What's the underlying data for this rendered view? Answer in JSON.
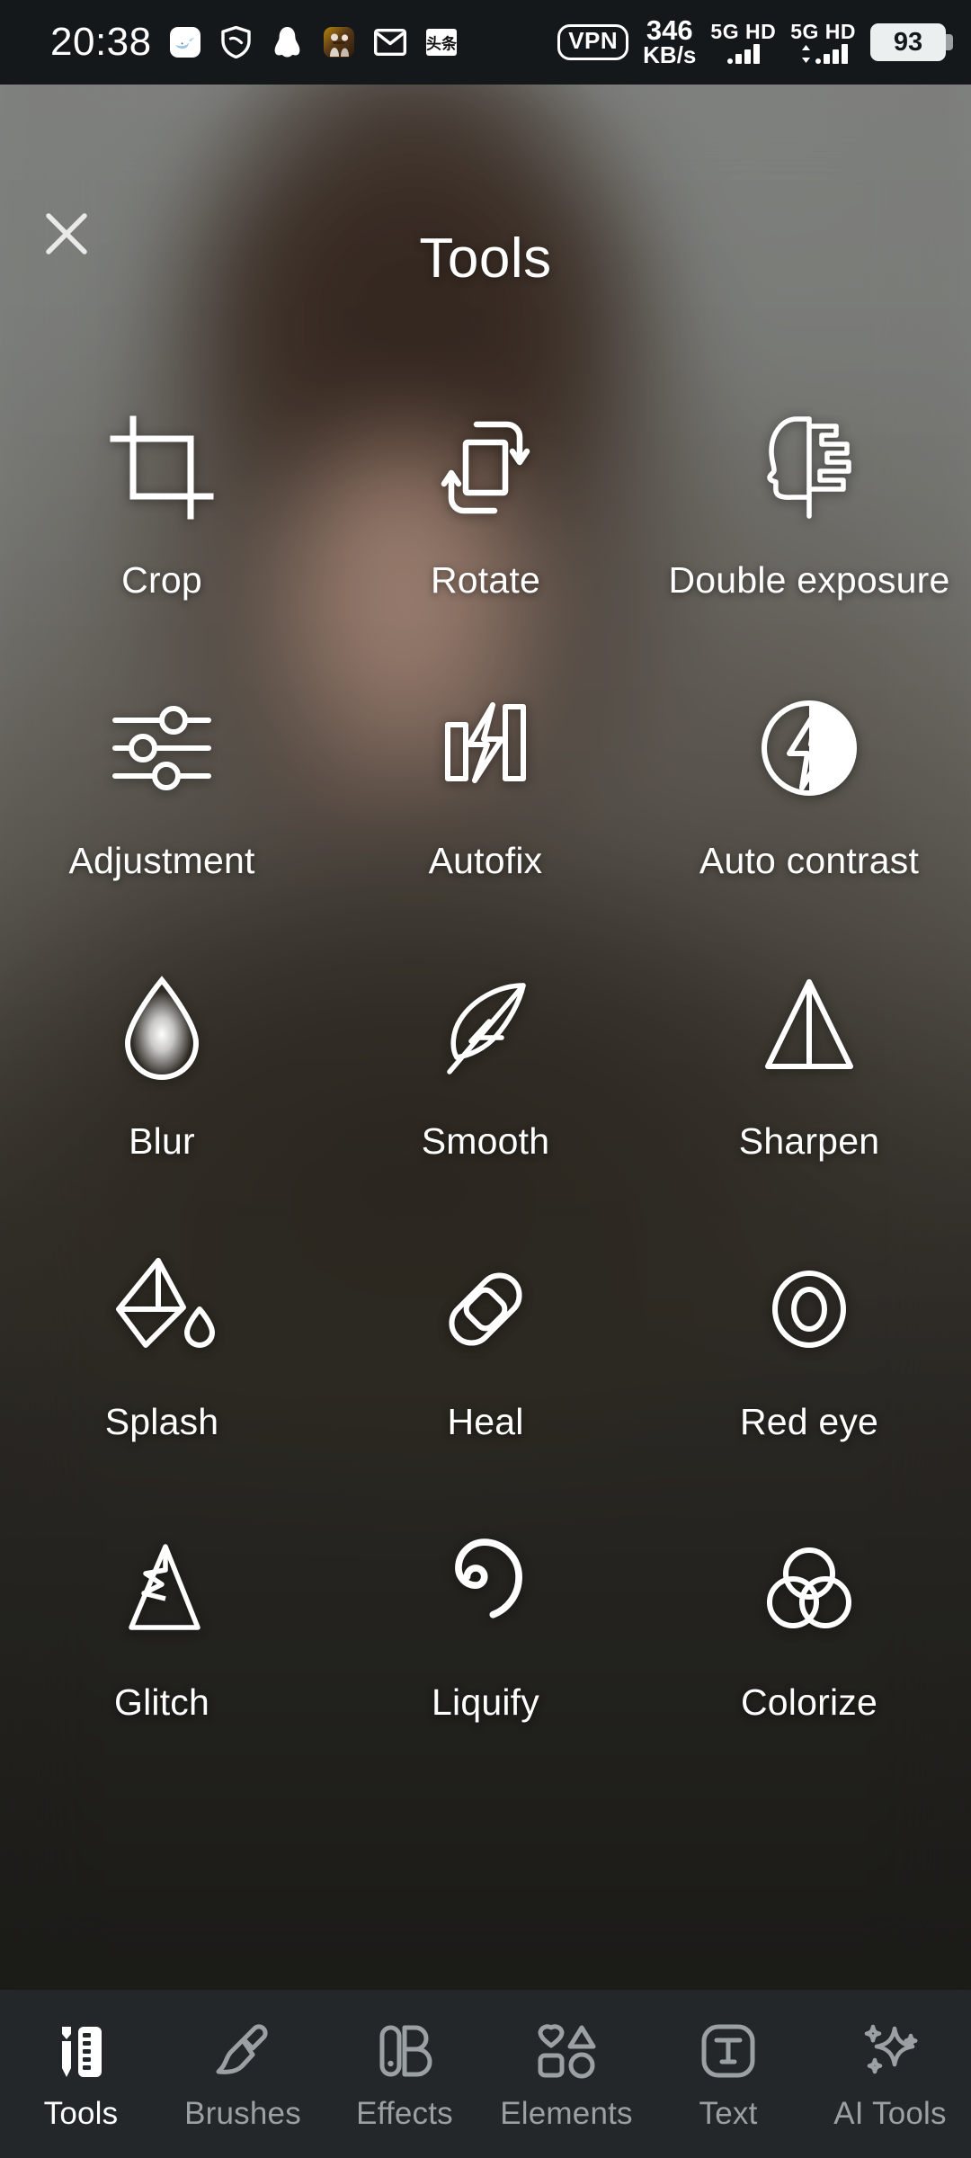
{
  "status_bar": {
    "time": "20:38",
    "left_icons": [
      "whale-app-icon",
      "shield-security-icon",
      "qq-penguin-icon",
      "game-app-icon",
      "mail-envelope-icon",
      "toutiao-app-icon"
    ],
    "vpn_label": "VPN",
    "net_speed_value": "346",
    "net_speed_unit": "KB/s",
    "sim1_label": "5G HD",
    "sim2_label": "5G HD",
    "battery_level": "93",
    "background_color": "#14181b"
  },
  "header": {
    "title": "Tools",
    "close_icon": "close-x-icon"
  },
  "tools": [
    {
      "label": "Crop",
      "icon": "crop-icon"
    },
    {
      "label": "Rotate",
      "icon": "rotate-icon"
    },
    {
      "label": "Double exposure",
      "icon": "double-exposure-head-icon"
    },
    {
      "label": "Adjustment",
      "icon": "sliders-icon"
    },
    {
      "label": "Autofix",
      "icon": "autofix-bars-bolt-icon"
    },
    {
      "label": "Auto contrast",
      "icon": "auto-contrast-circle-bolt-icon"
    },
    {
      "label": "Blur",
      "icon": "blur-droplet-icon"
    },
    {
      "label": "Smooth",
      "icon": "smooth-feather-icon"
    },
    {
      "label": "Sharpen",
      "icon": "sharpen-triangle-icon"
    },
    {
      "label": "Splash",
      "icon": "splash-paint-bucket-icon"
    },
    {
      "label": "Heal",
      "icon": "heal-bandage-icon"
    },
    {
      "label": "Red eye",
      "icon": "red-eye-icon"
    },
    {
      "label": "Glitch",
      "icon": "glitch-triangle-icon"
    },
    {
      "label": "Liquify",
      "icon": "liquify-spiral-icon"
    },
    {
      "label": "Colorize",
      "icon": "colorize-circles-icon"
    }
  ],
  "bottom_nav": {
    "active_index": 0,
    "items": [
      {
        "label": "Tools",
        "icon": "pen-ruler-icon",
        "active": true
      },
      {
        "label": "Brushes",
        "icon": "paintbrush-icon",
        "active": false
      },
      {
        "label": "Effects",
        "icon": "effects-icon",
        "active": false
      },
      {
        "label": "Elements",
        "icon": "shapes-icon",
        "active": false
      },
      {
        "label": "Text",
        "icon": "text-t-icon",
        "active": false
      },
      {
        "label": "AI Tools",
        "icon": "sparkles-icon",
        "active": false
      }
    ],
    "background_color": "#23272a",
    "active_color": "#ffffff",
    "inactive_color": "#9aa0a3"
  }
}
